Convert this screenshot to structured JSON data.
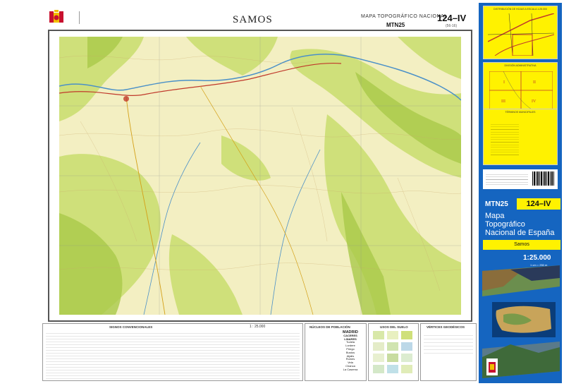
{
  "header": {
    "title": "SAMOS",
    "series_label": "MAPA TOPOGRÁFICO NACIONAL",
    "series_code": "MTN25",
    "sheet_code": "124–IV",
    "sheet_index": "(56-16)"
  },
  "legend": {
    "signs_title": "SIGNOS CONVENCIONALES",
    "scale_label": "1 : 25.000",
    "population_title": "NÚCLEOS DE POBLACIÓN",
    "population_examples": [
      "MADRID",
      "CACERES",
      "LINARES",
      "Tudela",
      "Lordere",
      "Priego",
      "Bustos",
      "Aljalis",
      "Ruines",
      "Vela",
      "Chanca",
      "La Caserna"
    ],
    "land_use_title": "USOS DEL SUELO",
    "geodesic_title": "VÉRTICES GEODÉSICOS"
  },
  "cover": {
    "series": "MTN25",
    "code": "124–IV",
    "title_lines": [
      "Mapa",
      "Topográfico",
      "Nacional de España"
    ],
    "sheet_name": "Samos",
    "scale": "1:25.000",
    "scale_sub": "1 cm = 250 m",
    "panel_caps": [
      "DISTRIBUCIÓN DE HOJAS A ESCALA 1:25.000",
      "DIVISIÓN ADMINISTRATIVA",
      "TÉRMINOS MUNICIPALES"
    ],
    "quadrants": [
      "I",
      "II",
      "III",
      "IV"
    ]
  },
  "colors": {
    "map_light": "#f3efc2",
    "map_green": "#cfe07a",
    "map_dark_green": "#a9c94a",
    "cover_blue": "#1565c0",
    "cover_yellow": "#fff200",
    "river": "#4a90c8",
    "road": "#c0392b"
  }
}
